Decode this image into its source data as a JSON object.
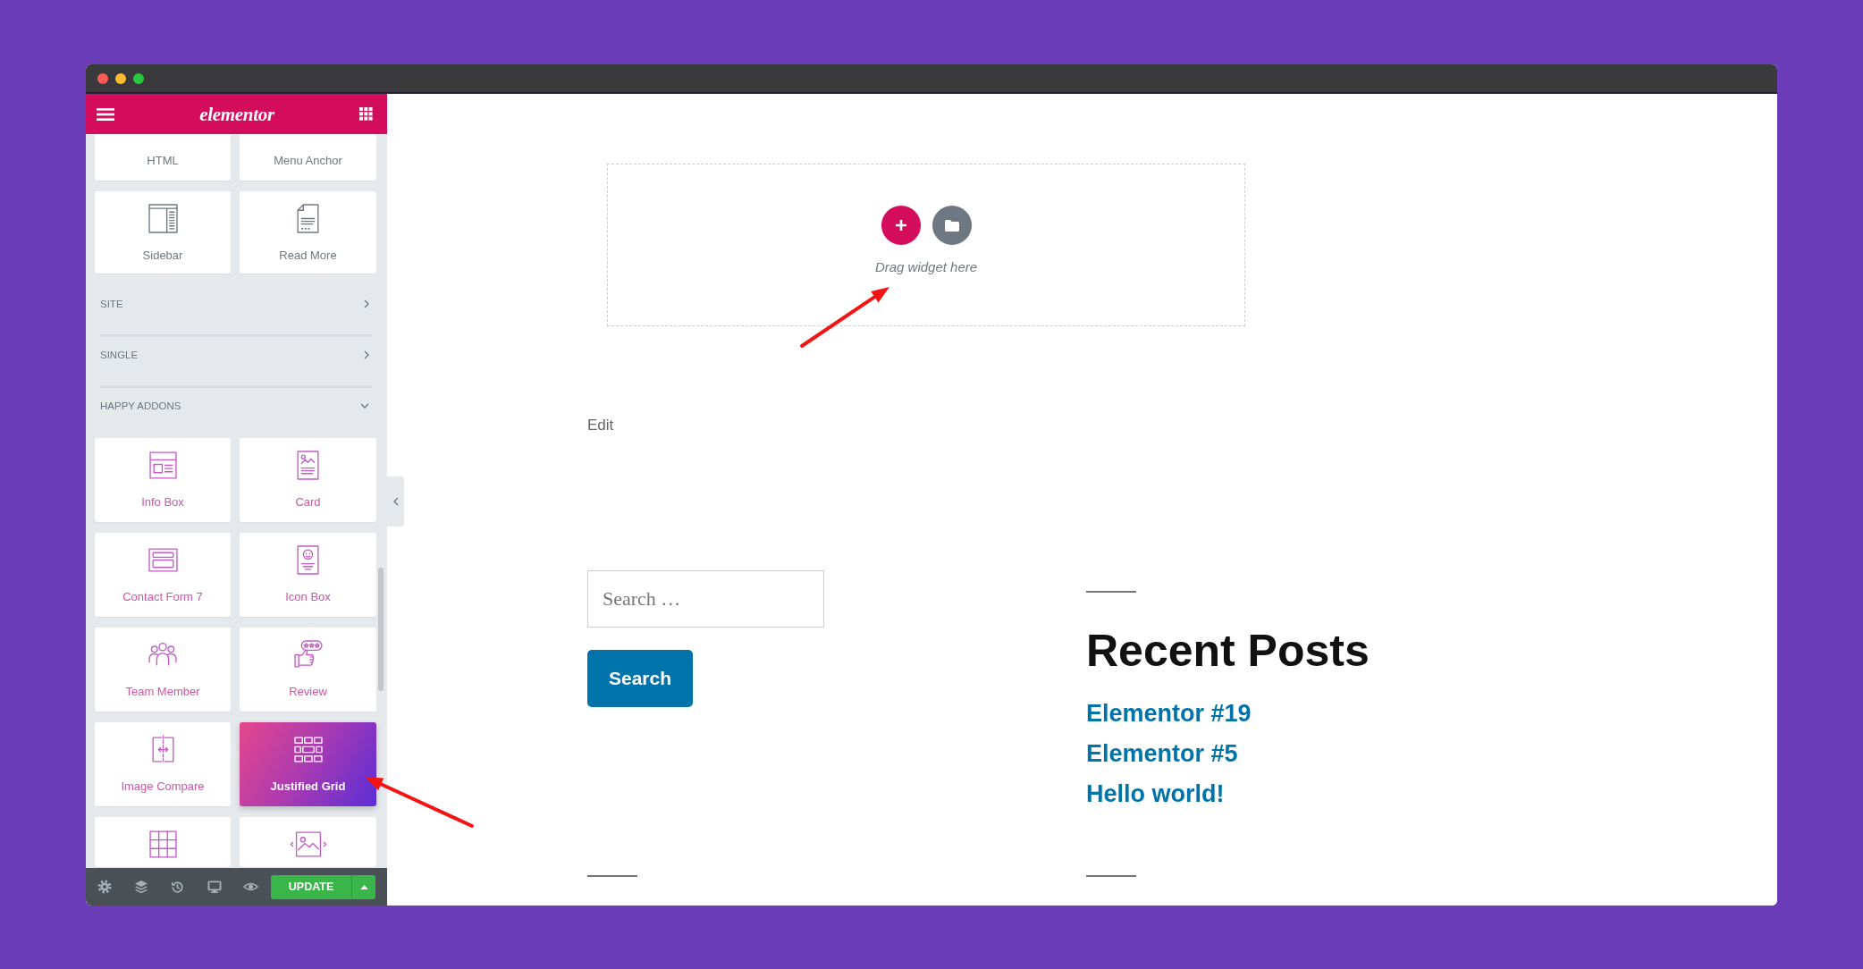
{
  "editor_panel": {
    "logo": "elementor",
    "widgets": [
      {
        "label": "HTML"
      },
      {
        "label": "Menu Anchor"
      },
      {
        "label": "Sidebar"
      },
      {
        "label": "Read More"
      }
    ],
    "categories": [
      {
        "label": "SITE",
        "expanded": false
      },
      {
        "label": "SINGLE",
        "expanded": false
      },
      {
        "label": "HAPPY ADDONS",
        "expanded": true,
        "widgets": [
          {
            "label": "Info Box",
            "selected": false
          },
          {
            "label": "Card",
            "selected": false
          },
          {
            "label": "Contact Form 7",
            "selected": false
          },
          {
            "label": "Icon Box",
            "selected": false
          },
          {
            "label": "Team Member",
            "selected": false
          },
          {
            "label": "Review",
            "selected": false
          },
          {
            "label": "Image Compare",
            "selected": false
          },
          {
            "label": "Justified Grid",
            "selected": true
          },
          {
            "selected": false
          },
          {
            "selected": false
          }
        ]
      }
    ],
    "footer": {
      "update_button": "UPDATE"
    }
  },
  "canvas": {
    "drop_zone": {
      "hint": "Drag widget here"
    },
    "edit_link": "Edit",
    "search_form": {
      "placeholder": "Search …",
      "button": "Search"
    },
    "recent_posts": {
      "title": "Recent Posts",
      "posts": [
        "Elementor #19",
        "Elementor #5",
        "Hello world!"
      ]
    }
  }
}
